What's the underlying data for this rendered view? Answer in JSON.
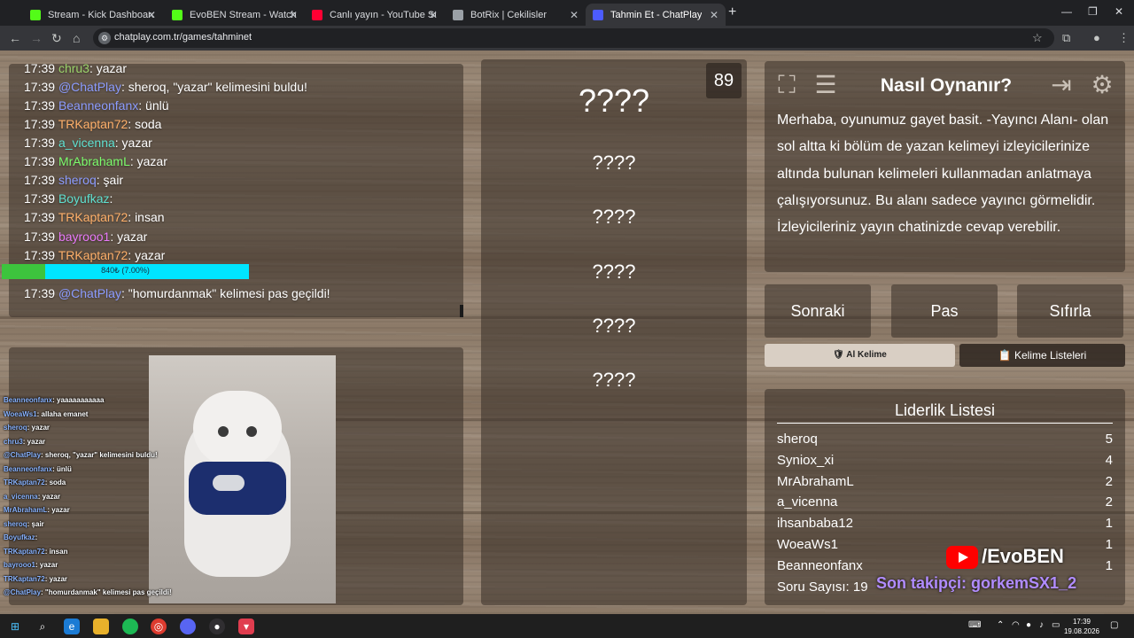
{
  "browser": {
    "tabs": [
      {
        "title": "Stream - Kick Dashboard",
        "color": "#53fc18"
      },
      {
        "title": "EvoBEN Stream - Watch Live on",
        "color": "#53fc18"
      },
      {
        "title": "Canlı yayın - YouTube Studio",
        "color": "#ff0033"
      },
      {
        "title": "BotRix | Cekilisler",
        "color": "#9aa0a6"
      },
      {
        "title": "Tahmin Et - ChatPlay",
        "color": "#4c5cff"
      }
    ],
    "url": "chatplay.com.tr/games/tahminet"
  },
  "chat": {
    "lines": [
      {
        "time": "17:39",
        "user": "chru3",
        "color": "#9bd36b",
        "msg": ": yazar"
      },
      {
        "time": "17:39",
        "user": "@ChatPlay",
        "color": "#8c9cff",
        "msg": ": sheroq, \"yazar\" kelimesini buldu!"
      },
      {
        "time": "17:39",
        "user": "Beanneonfanx",
        "color": "#8c9cff",
        "msg": ": ünlü"
      },
      {
        "time": "17:39",
        "user": "TRKaptan72",
        "color": "#ffb06a",
        "msg": ": soda"
      },
      {
        "time": "17:39",
        "user": "a_vicenna",
        "color": "#5fe0d0",
        "msg": ": yazar"
      },
      {
        "time": "17:39",
        "user": "MrAbrahamL",
        "color": "#7cfc6c",
        "msg": ": yazar"
      },
      {
        "time": "17:39",
        "user": "sheroq",
        "color": "#8c9cff",
        "msg": ": şair"
      },
      {
        "time": "17:39",
        "user": "Boyufkaz",
        "color": "#5fe0d0",
        "msg": ":"
      },
      {
        "time": "17:39",
        "user": "TRKaptan72",
        "color": "#ffb06a",
        "msg": ": insan"
      },
      {
        "time": "17:39",
        "user": "bayrooo1",
        "color": "#e879f9",
        "msg": ": yazar"
      },
      {
        "time": "17:39",
        "user": "TRKaptan72",
        "color": "#ffb06a",
        "msg": ": yazar"
      },
      {
        "time": "17:39",
        "user": "@ChatPlay",
        "color": "#8c9cff",
        "msg": ": \"homurdanmak\" kelimesi pas geçildi!"
      }
    ],
    "progress_text": "840₺ (7.00%)",
    "progress_fraction": 0.07
  },
  "game": {
    "timer": "89",
    "main_word": "????",
    "words": [
      "????",
      "????",
      "????",
      "????",
      "????"
    ]
  },
  "info": {
    "title": "Nasıl Oynanır?",
    "description": "Merhaba, oyunumuz gayet basit. -Yayıncı Alanı- olan sol altta ki bölüm de yazan kelimeyi izleyicilerinize altında bulunan kelimeleri kullanmadan anlatmaya çalışıyorsunuz. Bu alanı sadece yayıncı görmelidir. İzleyicileriniz yayın chatinizde cevap verebilir."
  },
  "controls": {
    "next": "Sonraki",
    "pass": "Pas",
    "reset": "Sıfırla",
    "get_word": "Al Kelime",
    "word_lists": "Kelime Listeleri"
  },
  "leaderboard": {
    "title": "Liderlik Listesi",
    "rows": [
      {
        "name": "sheroq",
        "score": "5"
      },
      {
        "name": "Syniox_xi",
        "score": "4"
      },
      {
        "name": "MrAbrahamL",
        "score": "2"
      },
      {
        "name": "a_vicenna",
        "score": "2"
      },
      {
        "name": "ihsanbaba12",
        "score": "1"
      },
      {
        "name": "WoeaWs1",
        "score": "1"
      },
      {
        "name": "Beanneonfanx",
        "score": "1"
      }
    ],
    "footer": "Soru Sayısı: 19"
  },
  "overlay": {
    "lines": [
      {
        "user": "Beanneonfanx",
        "msg": ": yaaaaaaaaaaa"
      },
      {
        "user": "WoeaWs1",
        "msg": ": allaha emanet"
      },
      {
        "user": "sheroq",
        "msg": ": yazar"
      },
      {
        "user": "chru3",
        "msg": ": yazar"
      },
      {
        "user": "@ChatPlay",
        "msg": ": sheroq, \"yazar\" kelimesini buldu!"
      },
      {
        "user": "Beanneonfanx",
        "msg": ": ünlü"
      },
      {
        "user": "TRKaptan72",
        "msg": ": soda"
      },
      {
        "user": "a_vicenna",
        "msg": ": yazar"
      },
      {
        "user": "MrAbrahamL",
        "msg": ": yazar"
      },
      {
        "user": "sheroq",
        "msg": ": şair"
      },
      {
        "user": "Boyufkaz",
        "msg": ":"
      },
      {
        "user": "TRKaptan72",
        "msg": ": insan"
      },
      {
        "user": "bayrooo1",
        "msg": ": yazar"
      },
      {
        "user": "TRKaptan72",
        "msg": ": yazar"
      },
      {
        "user": "@ChatPlay",
        "msg": ": \"homurdanmak\" kelimesi pas geçildi!"
      }
    ],
    "youtube_name": "/EvoBEN",
    "ticker": "Son takipçi: gorkemSX1_2"
  },
  "taskbar": {
    "time": "17:39",
    "date": "19.08.2026"
  }
}
